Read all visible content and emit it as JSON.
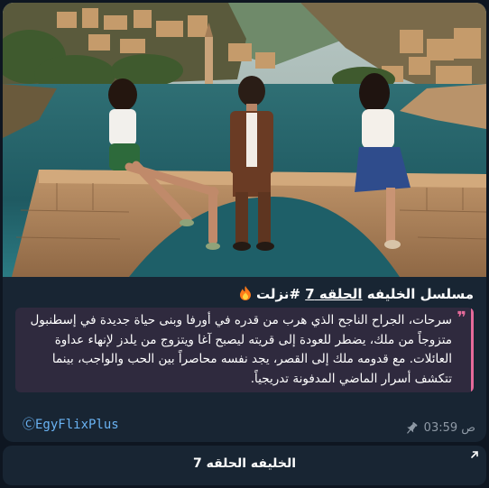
{
  "post": {
    "title_prefix": "مسلسل الخليفه ",
    "title_link": "الحلقه 7",
    "title_hashtag": " #نزلت",
    "fire_icon": "fire-icon",
    "description": "سرحات، الجراح الناجح الذي هرب من قدره في أورفا وبنى حياة جديدة في إسطنبول متزوجاً من ملك، يضطر للعودة إلى قريته ليصبح آغا ويتزوج من يلدز لإنهاء عداوة العائلات. مع قدومه ملك إلى القصر، يجد نفسه محاصراً بين الحب والواجب، بينما تتكشف أسرار الماضي المدفونة تدريجياً.",
    "source": "ⒸEgyFlixPlus",
    "time": "03:59 ص",
    "pin_icon": "pin-icon"
  },
  "action_button": {
    "label": "الخليفه الحلقه 7",
    "icon": "external-arrow-icon"
  },
  "colors": {
    "background": "#0e1621",
    "bubble": "#182533",
    "quote_accent": "#e56a9a",
    "link": "#6ab3f3"
  }
}
